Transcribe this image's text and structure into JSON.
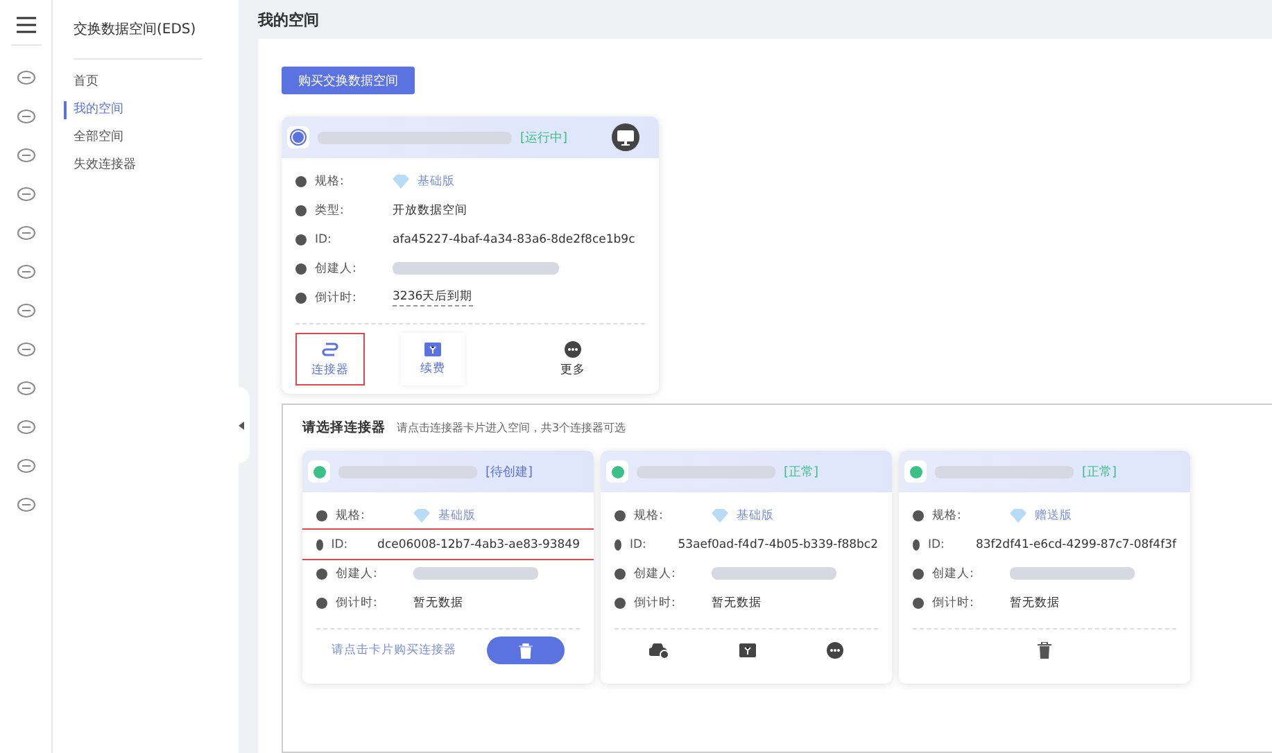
{
  "sidebar": {
    "title": "交换数据空间(EDS)",
    "items": [
      {
        "label": "首页",
        "selected": false
      },
      {
        "label": "我的空间",
        "selected": true
      },
      {
        "label": "全部空间",
        "selected": false
      },
      {
        "label": "失效连接器",
        "selected": false
      }
    ]
  },
  "page_title": "我的空间",
  "buy_button": "购买交换数据空间",
  "space_card": {
    "status": "[运行中]",
    "fields": [
      {
        "kind": "edition",
        "label": "规格:",
        "value": "基础版"
      },
      {
        "kind": "text",
        "label": "类型:",
        "value": "开放数据空间"
      },
      {
        "kind": "text",
        "label": "ID:",
        "value": "afa45227-4baf-4a34-83a6-8de2f8ce1b9c"
      },
      {
        "kind": "blurred",
        "label": "创建人:"
      },
      {
        "kind": "countdown",
        "label": "倒计时:",
        "value": "3236天后到期"
      }
    ],
    "actions": [
      {
        "kind": "connector",
        "label": "连接器",
        "highlighted": true
      },
      {
        "kind": "renew",
        "label": "续费",
        "highlighted": false
      },
      {
        "kind": "more",
        "label": "更多",
        "highlighted": false
      }
    ]
  },
  "connectors": {
    "title": "请选择连接器",
    "hint": "请点击连接器卡片进入空间，共3个连接器可选",
    "cards": [
      {
        "status": "[待创建]",
        "color": "#5b73e0",
        "fields": [
          {
            "kind": "edition",
            "label": "规格:",
            "value": "基础版",
            "highlighted": false
          },
          {
            "kind": "text",
            "label": "ID:",
            "value": "dce06008-12b7-4ab3-ae83-93849",
            "highlighted": true
          },
          {
            "kind": "blurred",
            "label": "创建人:",
            "highlighted": false
          },
          {
            "kind": "text",
            "label": "倒计时:",
            "value": "暂无数据",
            "highlighted": false
          }
        ],
        "footer": [
          {
            "kind": "buy_hint",
            "label": "请点击卡片购买连接器"
          },
          {
            "kind": "delete_pill"
          }
        ]
      },
      {
        "status": "[正常]",
        "color": "#3cc08a",
        "fields": [
          {
            "kind": "edition",
            "label": "规格:",
            "value": "基础版",
            "highlighted": false
          },
          {
            "kind": "text",
            "label": "ID:",
            "value": "53aef0ad-f4d7-4b05-b339-f88bc2",
            "highlighted": false
          },
          {
            "kind": "blurred",
            "label": "创建人:",
            "highlighted": false
          },
          {
            "kind": "text",
            "label": "倒计时:",
            "value": "暂无数据",
            "highlighted": false
          }
        ],
        "footer": [
          {
            "kind": "cloud"
          },
          {
            "kind": "renew"
          },
          {
            "kind": "more"
          }
        ]
      },
      {
        "status": "[正常]",
        "color": "#3cc08a",
        "fields": [
          {
            "kind": "edition",
            "label": "规格:",
            "value": "赠送版",
            "highlighted": false
          },
          {
            "kind": "text",
            "label": "ID:",
            "value": "83f2df41-e6cd-4299-87c7-08f4f3f",
            "highlighted": false
          },
          {
            "kind": "blurred",
            "label": "创建人:",
            "highlighted": false
          },
          {
            "kind": "text",
            "label": "倒计时:",
            "value": "暂无数据",
            "highlighted": false
          }
        ],
        "footer": [
          {
            "kind": "delete"
          }
        ]
      }
    ]
  }
}
